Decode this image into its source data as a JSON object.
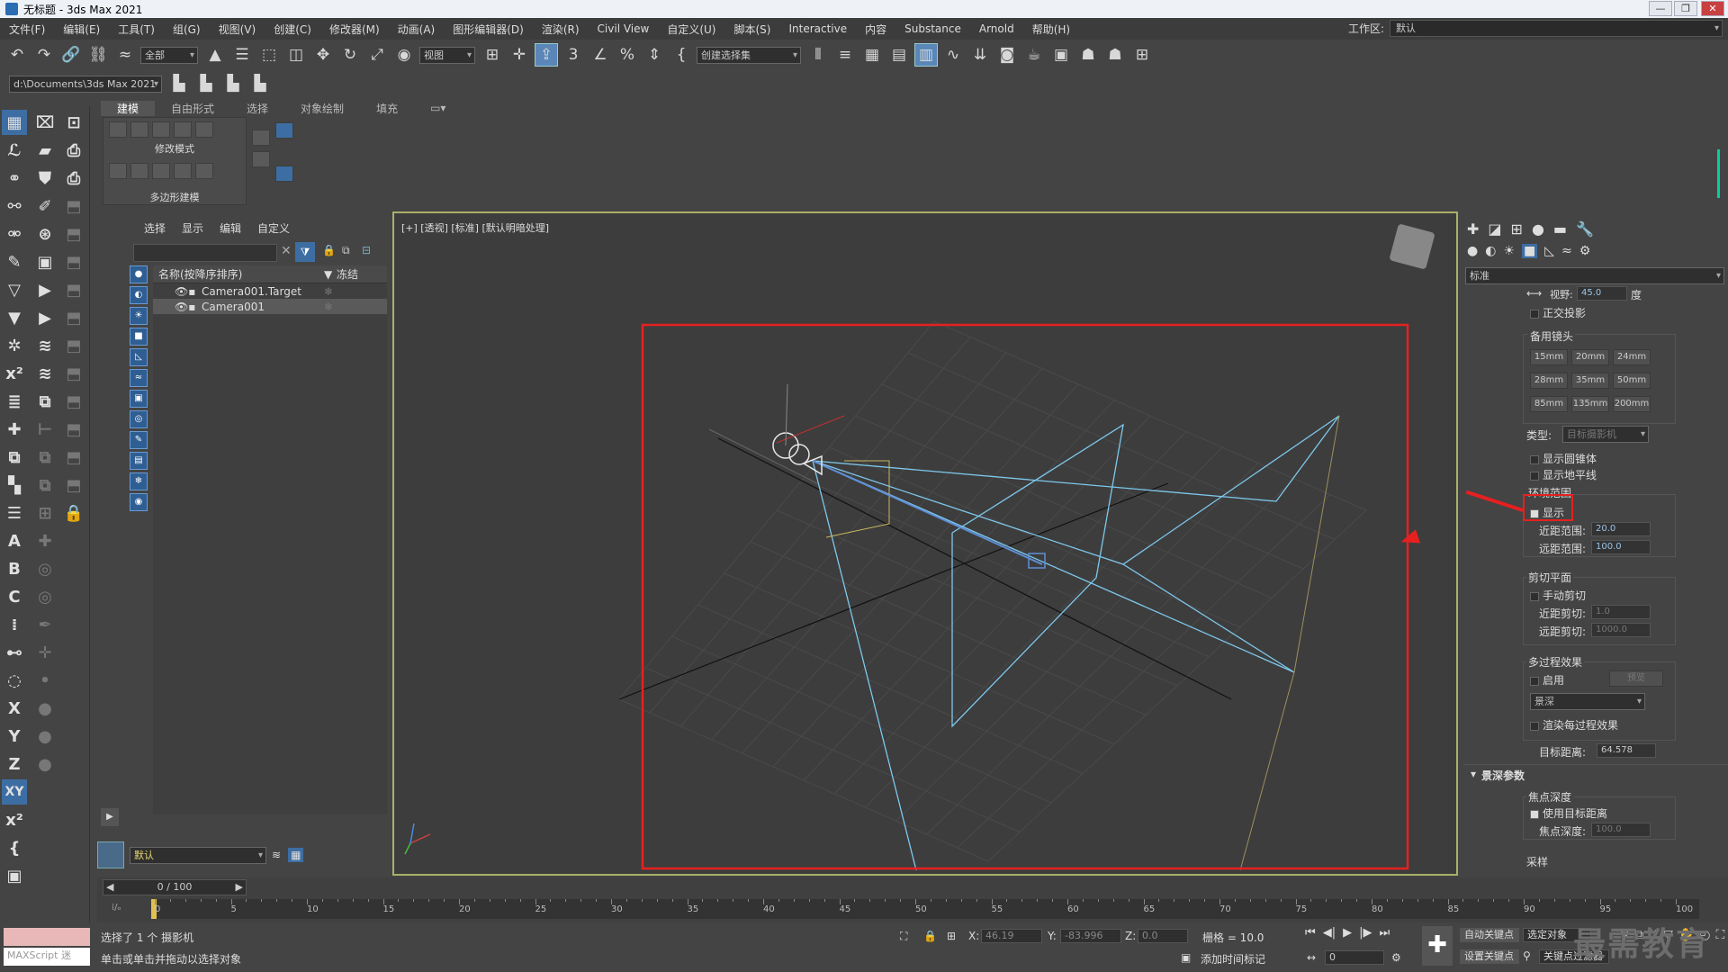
{
  "title": "无标题 - 3ds Max 2021",
  "window_buttons": [
    "—",
    "❐",
    "✕"
  ],
  "menu": [
    "文件(F)",
    "编辑(E)",
    "工具(T)",
    "组(G)",
    "视图(V)",
    "创建(C)",
    "修改器(M)",
    "动画(A)",
    "图形编辑器(D)",
    "渲染(R)",
    "Civil View",
    "自定义(U)",
    "脚本(S)",
    "Interactive",
    "内容",
    "Substance",
    "Arnold",
    "帮助(H)"
  ],
  "workspace": {
    "label": "工作区:",
    "value": "默认"
  },
  "toolbar": {
    "filter": "全部",
    "ref_coord": "视图",
    "selection_set": "创建选择集"
  },
  "project_path": "d:\\Documents\\3ds Max 2021",
  "ribbon": {
    "tabs": [
      "建模",
      "自由形式",
      "选择",
      "对象绘制",
      "填充"
    ],
    "active_tab": "建模",
    "panel1": "修改模式",
    "panel2": "多边形建模"
  },
  "scene_explorer": {
    "tabs": [
      "选择",
      "显示",
      "编辑",
      "自定义"
    ],
    "col_name": "名称(按降序排序)",
    "col_frozen": "冻结",
    "items": [
      {
        "name": "Camera001.Target",
        "selected": false
      },
      {
        "name": "Camera001",
        "selected": true
      }
    ],
    "layer": "默认"
  },
  "viewport": {
    "label": "[+] [透视] [标准] [默认明暗处理]",
    "highlight_color": "#e62020"
  },
  "cmd_panel": {
    "category": "标准",
    "fov_label": "视野:",
    "fov_value": "45.0",
    "fov_unit": "度",
    "ortho": "正交投影",
    "stock_lens_title": "备用镜头",
    "lenses": [
      "15mm",
      "20mm",
      "24mm",
      "28mm",
      "35mm",
      "50mm",
      "85mm",
      "135mm",
      "200mm"
    ],
    "type_label": "类型:",
    "type_value": "目标摄影机",
    "show_cone": "显示圆锥体",
    "show_horizon": "显示地平线",
    "env_title": "环境范围",
    "env_show": "显示",
    "near_range_label": "近距范围:",
    "near_range": "20.0",
    "far_range_label": "远距范围:",
    "far_range": "100.0",
    "clip_title": "剪切平面",
    "manual_clip": "手动剪切",
    "near_clip_label": "近距剪切:",
    "near_clip": "1.0",
    "far_clip_label": "远距剪切:",
    "far_clip": "1000.0",
    "mp_title": "多过程效果",
    "mp_enable": "启用",
    "mp_preview": "预览",
    "mp_effect": "景深",
    "mp_render": "渲染每过程效果",
    "target_label": "目标距离:",
    "target_value": "64.578",
    "dof_rollout": "景深参数",
    "focal_title": "焦点深度",
    "use_target": "使用目标距离",
    "focal_label": "焦点深度:",
    "focal_value": "100.0",
    "sampling_title": "采样"
  },
  "timeline": {
    "frame": "0 / 100",
    "ticks": [
      "0",
      "5",
      "10",
      "15",
      "20",
      "25",
      "30",
      "35",
      "40",
      "45",
      "50",
      "55",
      "60",
      "65",
      "70",
      "75",
      "80",
      "85",
      "90",
      "95",
      "100"
    ]
  },
  "status": {
    "selected": "选择了 1 个 摄影机",
    "hint": "单击或单击并拖动以选择对象",
    "maxscript": "MAXScript 迷",
    "x_label": "X:",
    "x": "46.19",
    "y_label": "Y:",
    "y": "-83.996",
    "z_label": "Z:",
    "z": "0.0",
    "grid": "栅格 = 10.0",
    "add_tag": "添加时间标记",
    "auto_key": "自动关键点",
    "set_key": "设置关键点",
    "sel_obj": "选定对象",
    "key_filter": "关键点过滤器",
    "frame_field": "0"
  },
  "watermark": "最需教育"
}
